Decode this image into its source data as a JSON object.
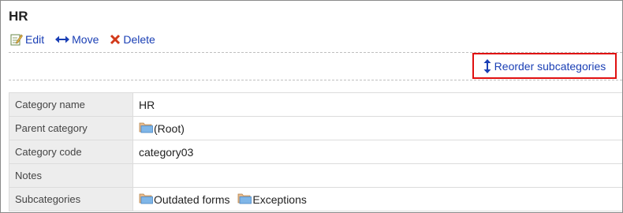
{
  "page": {
    "title": "HR"
  },
  "toolbar": {
    "edit_label": "Edit",
    "move_label": "Move",
    "delete_label": "Delete",
    "reorder_label": "Reorder subcategories"
  },
  "details": {
    "category_name": {
      "label": "Category name",
      "value": "HR"
    },
    "parent_category": {
      "label": "Parent category",
      "value": "(Root)"
    },
    "category_code": {
      "label": "Category code",
      "value": "category03"
    },
    "notes": {
      "label": "Notes",
      "value": ""
    },
    "subcategories": {
      "label": "Subcategories",
      "items": [
        "Outdated forms",
        "Exceptions"
      ]
    }
  },
  "colors": {
    "link": "#1a3fb5",
    "highlight_border": "#e01010",
    "label_bg": "#ededed"
  },
  "icons": [
    "edit-icon",
    "move-icon",
    "delete-icon",
    "reorder-icon",
    "folder-icon"
  ]
}
